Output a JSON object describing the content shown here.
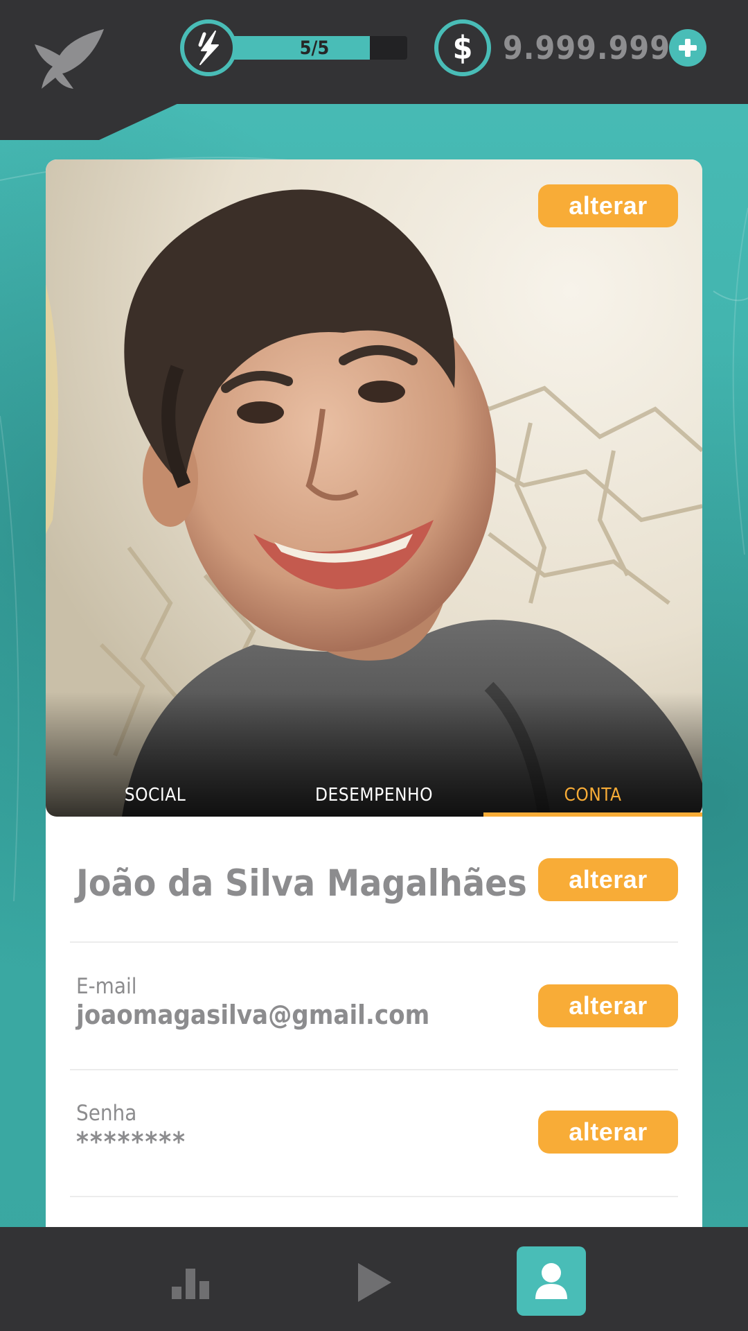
{
  "header": {
    "energy_text": "5/5",
    "energy_fraction": 0.8,
    "coins": "9.999.999",
    "coin_symbol": "$"
  },
  "profile": {
    "photo_change_label": "alterar",
    "tabs": [
      {
        "label": "SOCIAL",
        "active": false
      },
      {
        "label": "DESEMPENHO",
        "active": false
      },
      {
        "label": "CONTA",
        "active": true
      }
    ],
    "name": "João da Silva Magalhães",
    "name_change_label": "alterar",
    "email_label": "E-mail",
    "email_value": "joaomagasilva@gmail.com",
    "email_change_label": "alterar",
    "password_label": "Senha",
    "password_value": "********",
    "password_change_label": "alterar"
  },
  "nav": {
    "items": [
      {
        "icon": "ranking-icon",
        "active": false
      },
      {
        "icon": "play-icon",
        "active": false
      },
      {
        "icon": "profile-icon",
        "active": true
      }
    ]
  },
  "colors": {
    "teal": "#49bdb7",
    "orange": "#f8ac37",
    "dark": "#333335",
    "gray_text": "#8c8c8e"
  }
}
